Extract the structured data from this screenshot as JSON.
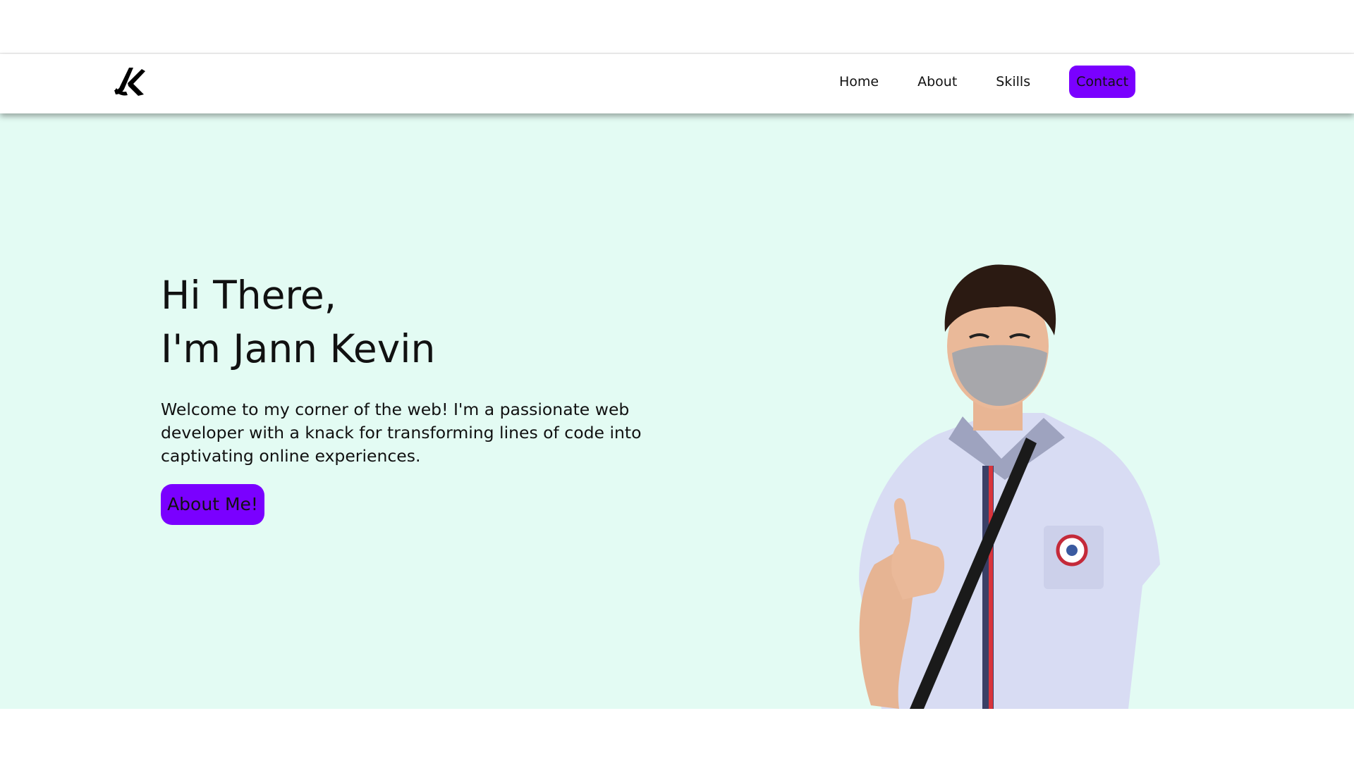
{
  "header": {
    "logo_icon": "jk-monogram-logo",
    "nav": [
      {
        "label": "Home"
      },
      {
        "label": "About"
      },
      {
        "label": "Skills"
      }
    ],
    "contact_label": "Contact",
    "accent_color": "#7a00ff"
  },
  "hero": {
    "greeting": "Hi There,",
    "name_line": "I'm Jann Kevin",
    "intro": "Welcome to my corner of the web! I'm a passionate web developer with a knack for transforming lines of code into captivating online experiences.",
    "cta_label": "About Me!",
    "background_color": "#e3fbf3",
    "photo_icon": "profile-photo"
  }
}
